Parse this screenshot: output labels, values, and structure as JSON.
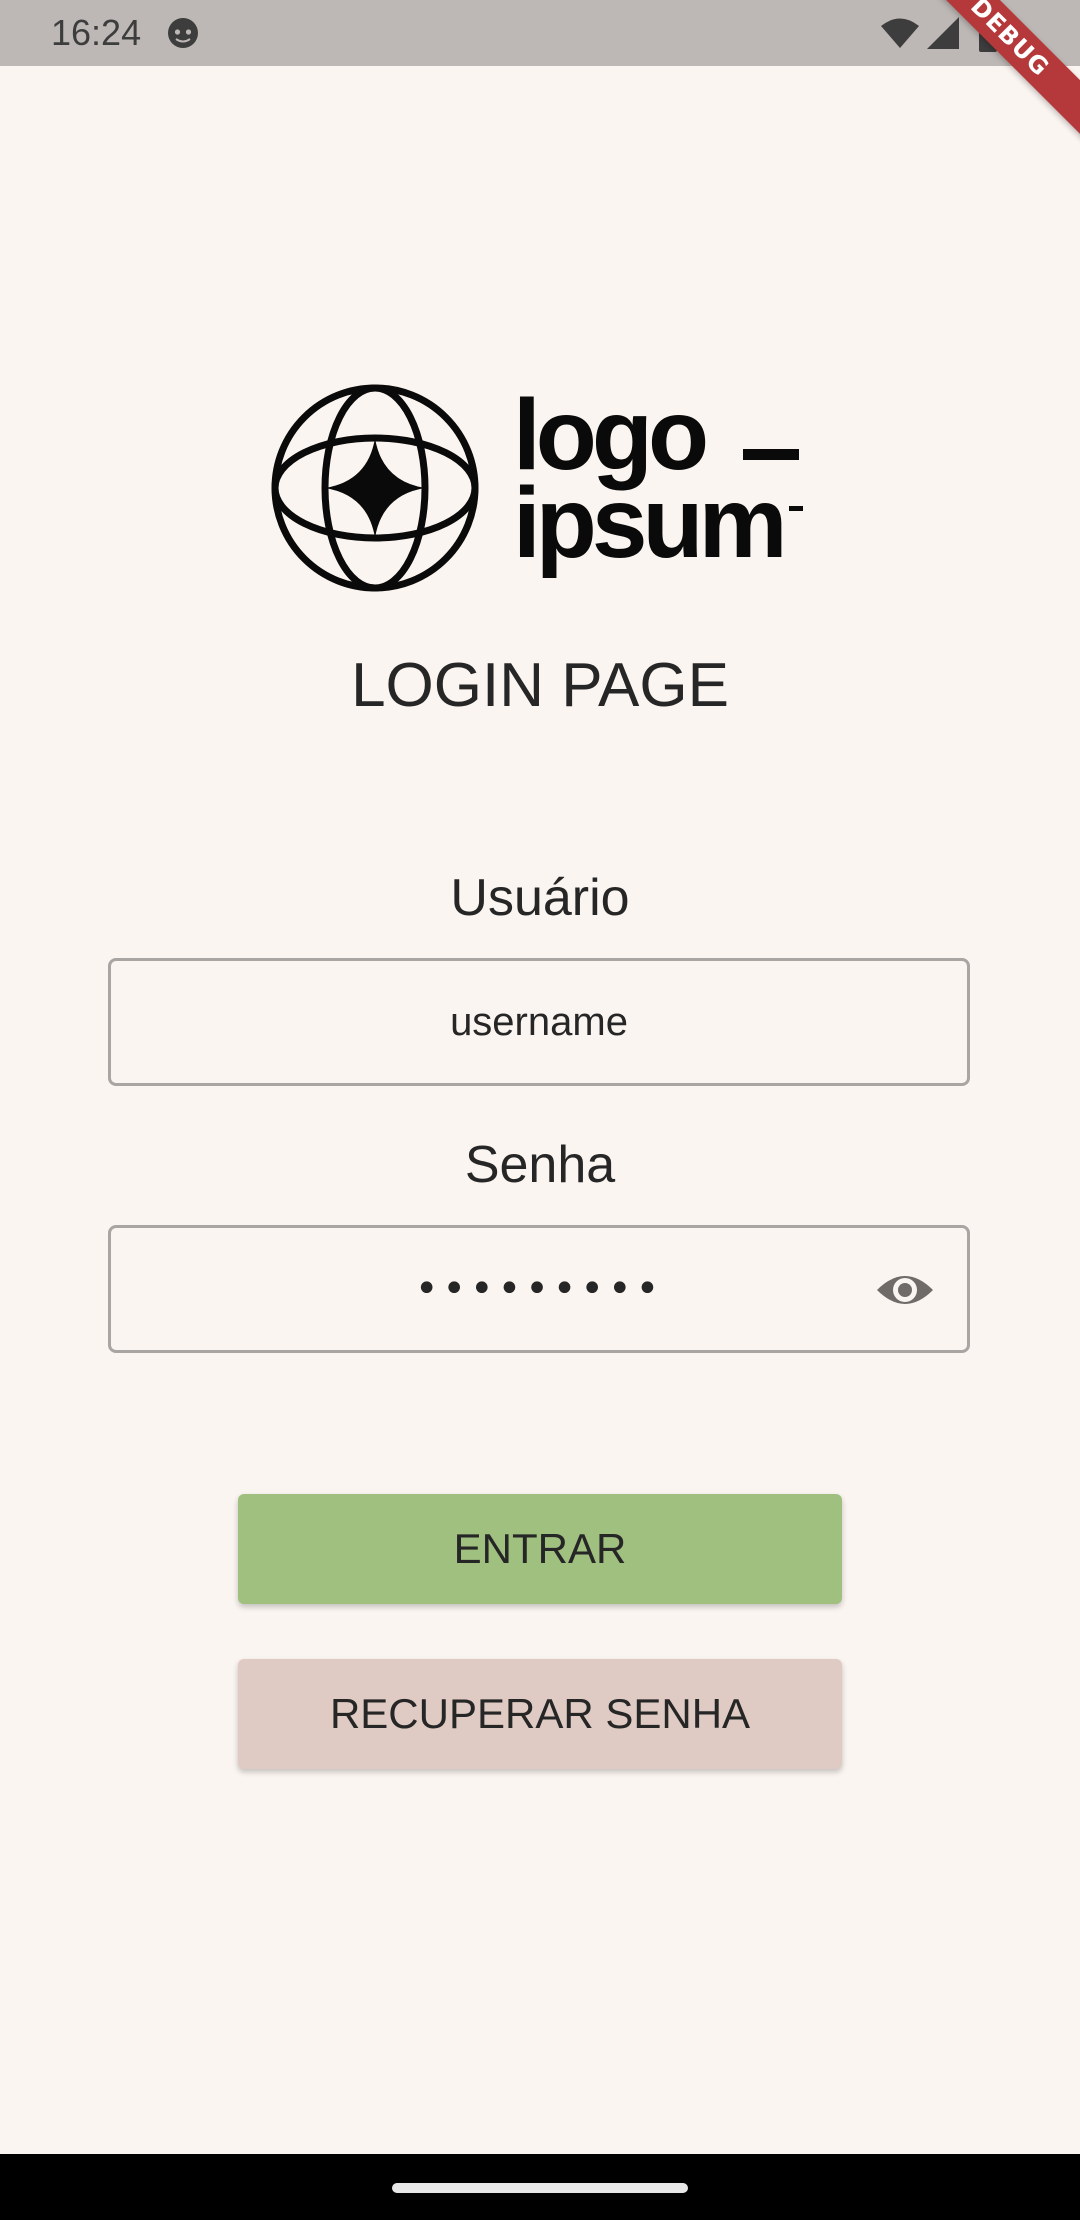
{
  "status_bar": {
    "time": "16:24",
    "icons": [
      "notification-face-icon",
      "wifi-icon",
      "signal-icon",
      "battery-icon"
    ]
  },
  "debug_banner": {
    "label": "DEBUG",
    "color": "#b5393a"
  },
  "logo": {
    "line1": "logo",
    "line2": "ipsum",
    "icon": "globe-star-icon"
  },
  "page": {
    "title": "LOGIN PAGE"
  },
  "form": {
    "username_label": "Usuário",
    "username_value": "username",
    "password_label": "Senha",
    "password_value": "•••••••••",
    "password_toggle_icon": "eye-icon"
  },
  "buttons": {
    "login": "ENTRAR",
    "recover": "RECUPERAR SENHA"
  },
  "colors": {
    "background": "#fbf5f1",
    "login_button": "#a0c080",
    "recover_button": "#dfcbc3",
    "status_bar": "#bdb8b5"
  }
}
